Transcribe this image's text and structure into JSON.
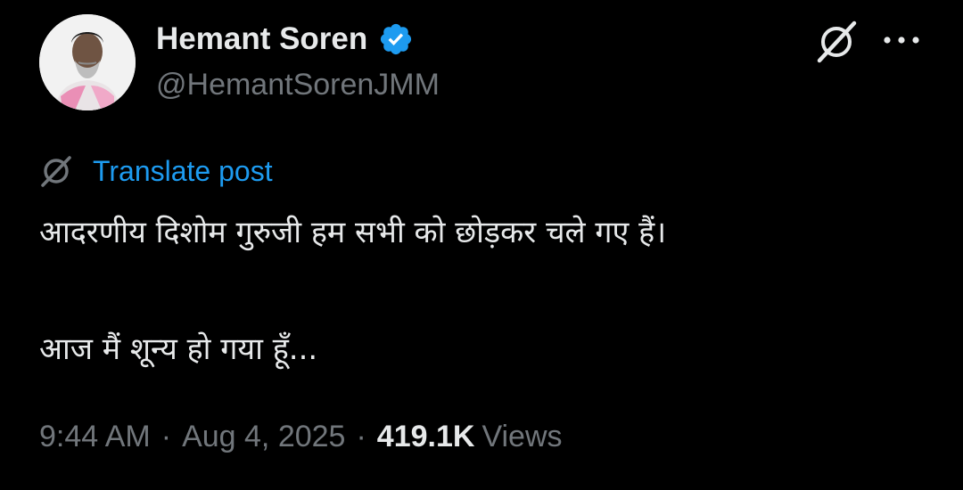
{
  "author": {
    "display_name": "Hemant Soren",
    "handle": "@HemantSorenJMM",
    "verified": true
  },
  "actions": {
    "grok_icon": "grok-slash-icon",
    "more_icon": "more-horizontal-icon"
  },
  "translate": {
    "label": "Translate post",
    "icon": "grok-slash-icon"
  },
  "post": {
    "line1": "आदरणीय दिशोम गुरुजी हम सभी को छोड़कर चले गए हैं।",
    "line2": "आज मैं शून्य हो गया हूँ..."
  },
  "meta": {
    "time": "9:44 AM",
    "separator": "·",
    "date": "Aug 4, 2025",
    "views_count": "419.1K",
    "views_label": "Views"
  },
  "colors": {
    "background": "#000000",
    "primary_text": "#e7e9ea",
    "secondary_text": "#71767b",
    "accent": "#1d9bf0"
  }
}
